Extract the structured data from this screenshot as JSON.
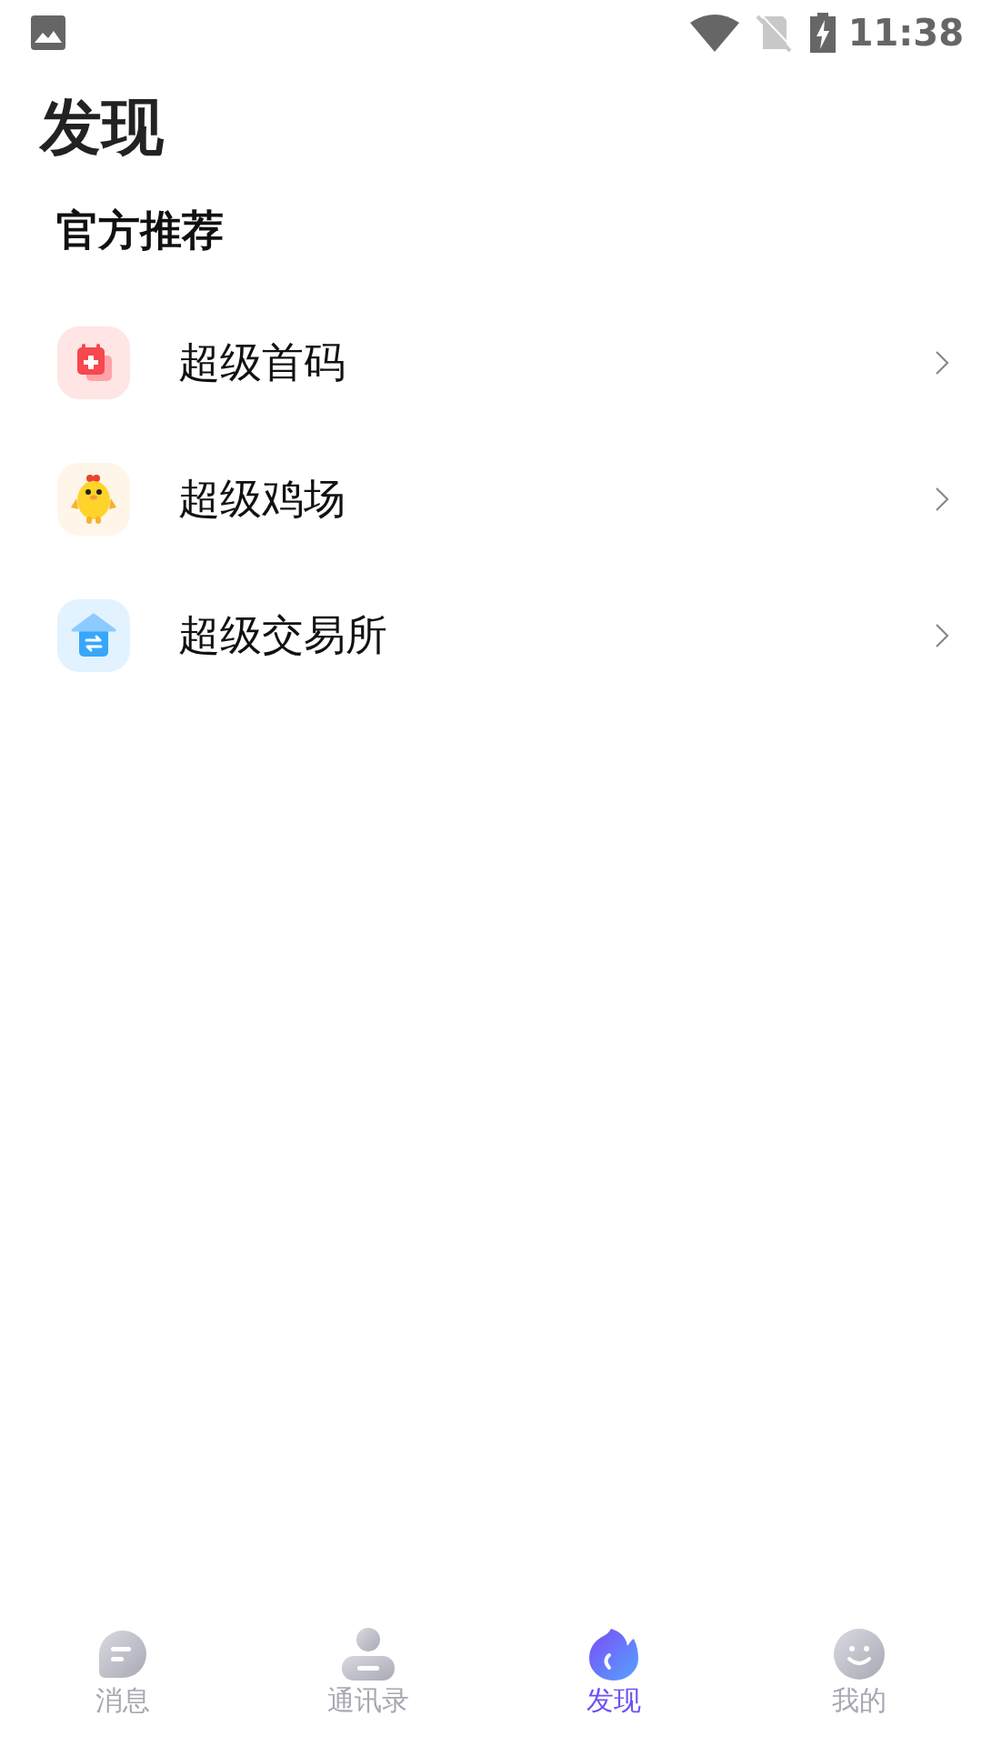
{
  "status_bar": {
    "time": "11:38"
  },
  "title": "发现",
  "section": {
    "title": "官方推荐",
    "items": [
      {
        "label": "超级首码",
        "kind": "calendar"
      },
      {
        "label": "超级鸡场",
        "kind": "chick"
      },
      {
        "label": "超级交易所",
        "kind": "exchange"
      }
    ]
  },
  "bottom_nav": [
    {
      "label": "消息",
      "kind": "chat",
      "selected": false
    },
    {
      "label": "通讯录",
      "kind": "contact",
      "selected": false
    },
    {
      "label": "发现",
      "kind": "flame",
      "selected": true
    },
    {
      "label": "我的",
      "kind": "face",
      "selected": false
    }
  ]
}
